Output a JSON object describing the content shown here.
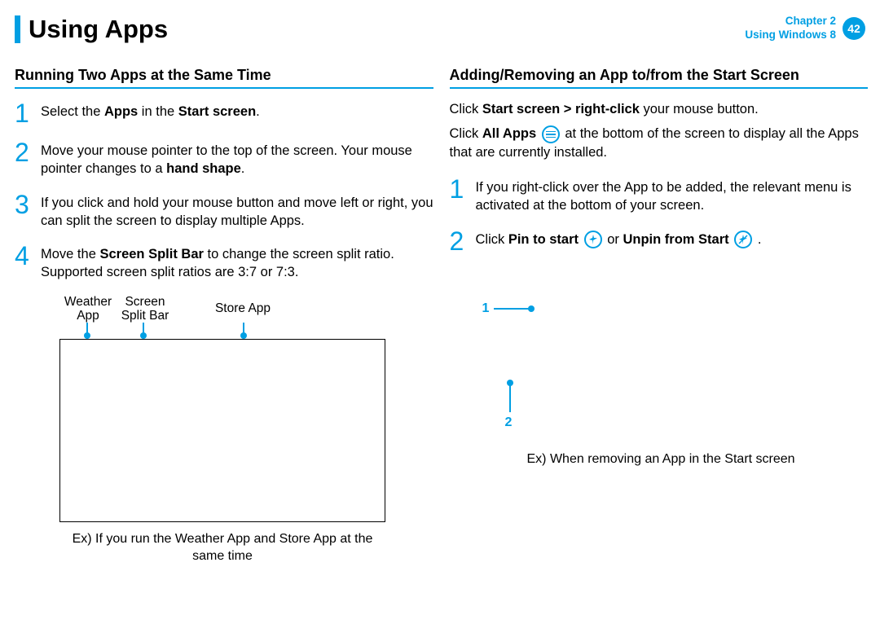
{
  "header": {
    "title": "Using Apps",
    "chapter_line1": "Chapter 2",
    "chapter_line2": "Using Windows 8",
    "page_number": "42"
  },
  "left": {
    "section_title": "Running Two Apps at the Same Time",
    "steps": {
      "s1": {
        "num": "1",
        "pre": "Select the ",
        "b1": "Apps",
        "mid": " in the ",
        "b2": "Start screen",
        "post": "."
      },
      "s2": {
        "num": "2",
        "pre": " Move your mouse pointer to the top of the screen. Your mouse pointer changes to a ",
        "b1": "hand shape",
        "post": "."
      },
      "s3": {
        "num": "3",
        "text": "If you click and hold your mouse button and move left or right, you can split the screen to display multiple Apps."
      },
      "s4": {
        "num": "4",
        "pre": "Move the ",
        "b1": "Screen Split Bar",
        "post": " to change the screen split ratio. Supported screen split ratios are 3:7 or 7:3."
      }
    },
    "diagram": {
      "label_weather_l1": "Weather",
      "label_weather_l2": "App",
      "label_split_l1": "Screen",
      "label_split_l2": "Split Bar",
      "label_store": "Store App",
      "caption": "Ex) If you run the Weather App and Store App at the same time"
    }
  },
  "right": {
    "section_title": "Adding/Removing an App to/from the Start Screen",
    "intro": {
      "p1_pre": "Click ",
      "p1_b1": "Start screen > right-click",
      "p1_post": " your mouse button.",
      "p2_pre": "Click ",
      "p2_b1": "All Apps",
      "p2_post1": " at the bottom of the screen to display all the Apps that are currently installed."
    },
    "steps": {
      "s1": {
        "num": "1",
        "text": "If you right-click over the App to be added, the relevant menu is activated at the bottom of your screen."
      },
      "s2": {
        "num": "2",
        "pre": "Click ",
        "b1": "Pin to start ",
        "mid": " or ",
        "b2": "Unpin from Start",
        "post": " ."
      }
    },
    "callouts": {
      "c1": "1",
      "c2": "2",
      "caption": "Ex) When removing an App in the Start screen"
    }
  }
}
